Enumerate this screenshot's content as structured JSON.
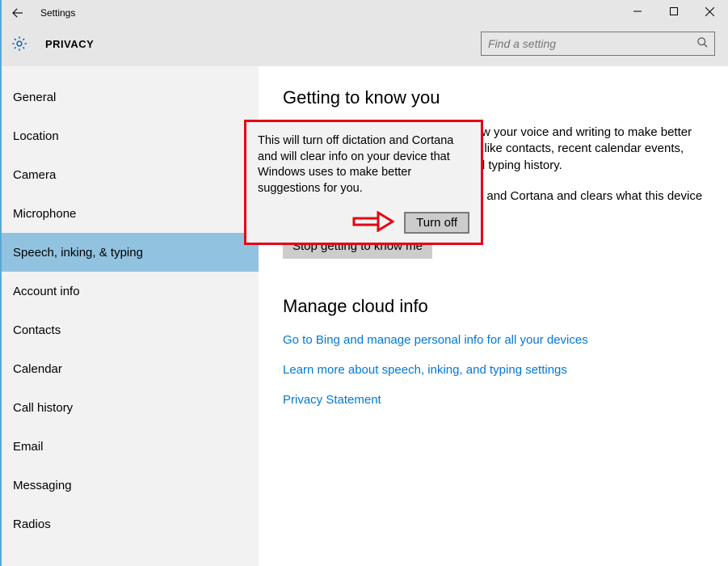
{
  "window": {
    "title": "Settings"
  },
  "header": {
    "label": "PRIVACY",
    "search_placeholder": "Find a setting"
  },
  "sidebar": {
    "items": [
      {
        "label": "General"
      },
      {
        "label": "Location"
      },
      {
        "label": "Camera"
      },
      {
        "label": "Microphone"
      },
      {
        "label": "Speech, inking, & typing"
      },
      {
        "label": "Account info"
      },
      {
        "label": "Contacts"
      },
      {
        "label": "Calendar"
      },
      {
        "label": "Call history"
      },
      {
        "label": "Email"
      },
      {
        "label": "Messaging"
      },
      {
        "label": "Radios"
      }
    ],
    "selected_index": 4
  },
  "main": {
    "heading1": "Getting to know you",
    "desc1": "Windows and Cortana can get to know your voice and writing to make better suggestions for you. We'll collect info like contacts, recent calendar events, speech and handwriting patterns, and typing history.",
    "desc2": "Turning this off also turns off dictation and Cortana and clears what this device knows about you.",
    "stop_button": "Stop getting to know me",
    "heading2": "Manage cloud info",
    "links": [
      "Go to Bing and manage personal info for all your devices",
      "Learn more about speech, inking, and typing settings",
      "Privacy Statement"
    ]
  },
  "dialog": {
    "text": "This will turn off dictation and Cortana and will clear info on your device that Windows uses to make better suggestions for you.",
    "button": "Turn off"
  }
}
